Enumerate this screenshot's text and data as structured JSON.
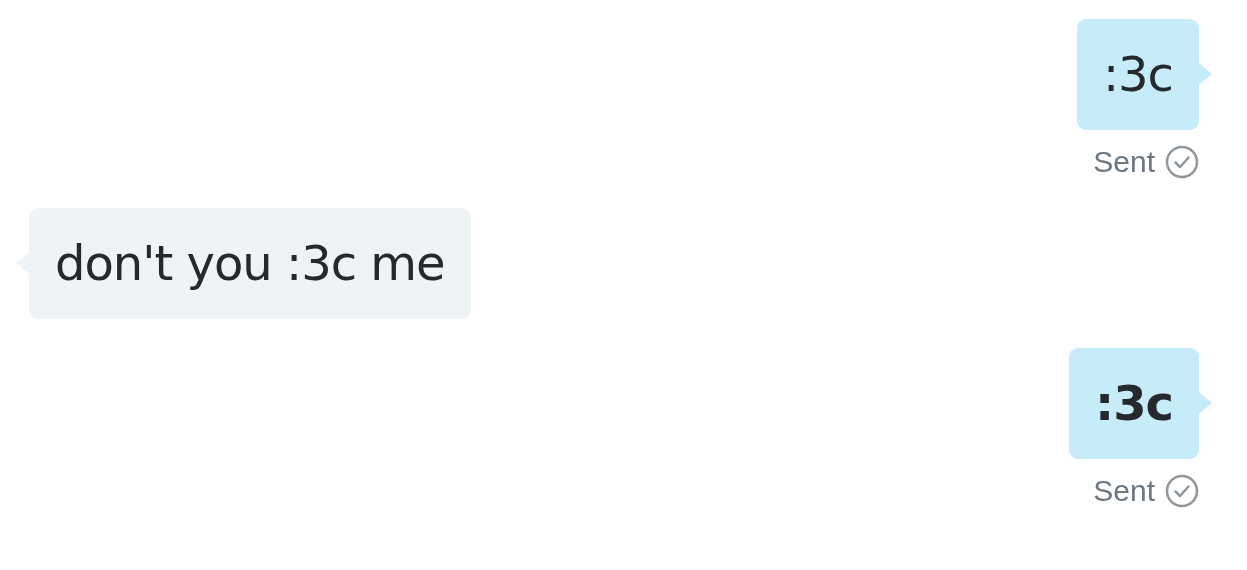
{
  "messages": [
    {
      "kind": "outgoing",
      "text": ":3c",
      "bold": false,
      "status": "Sent"
    },
    {
      "kind": "incoming",
      "text": "don't you :3c me",
      "bold": false
    },
    {
      "kind": "outgoing",
      "text": ":3c",
      "bold": true,
      "status": "Sent"
    }
  ]
}
